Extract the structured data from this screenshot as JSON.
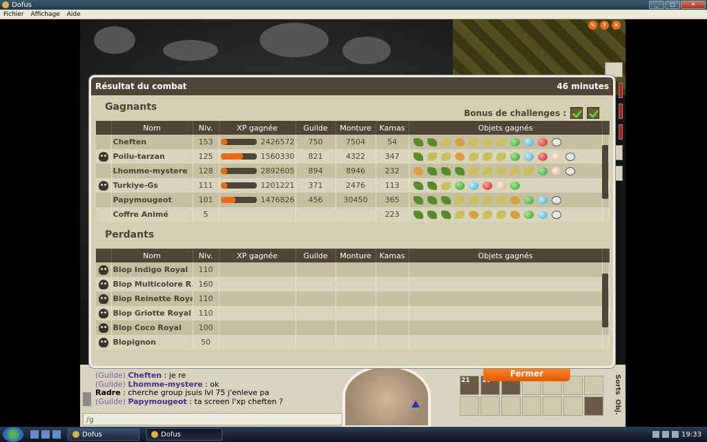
{
  "window": {
    "title": "Dofus"
  },
  "menu": [
    "Fichier",
    "Affichage",
    "Aide"
  ],
  "panel": {
    "title": "Résultat du combat",
    "duration": "46 minutes",
    "bonus_label": "Bonus de challenges :",
    "winners_title": "Gagnants",
    "losers_title": "Perdants",
    "columns": {
      "name": "Nom",
      "level": "Niv.",
      "xp": "XP gagnée",
      "guild": "Guilde",
      "mount": "Monture",
      "kamas": "Kamas",
      "items": "Objets gagnés"
    },
    "winners": [
      {
        "name": "Cheften",
        "dead": false,
        "level": "153",
        "xp": "2426572",
        "xp_fill": 0.18,
        "guild": "750",
        "mount": "7504",
        "kamas": "54",
        "items": [
          "g",
          "g",
          "y",
          "o",
          "y",
          "y",
          "y",
          "gr",
          "bl",
          "r",
          "d"
        ]
      },
      {
        "name": "Poilu-tarzan",
        "dead": true,
        "level": "125",
        "xp": "1560330",
        "xp_fill": 0.62,
        "guild": "821",
        "mount": "4322",
        "kamas": "347",
        "items": [
          "g",
          "y",
          "y",
          "o",
          "y",
          "y",
          "y",
          "gr",
          "bl",
          "r",
          "pe",
          "d"
        ]
      },
      {
        "name": "Lhomme-mystere",
        "dead": false,
        "level": "128",
        "xp": "2892605",
        "xp_fill": 0.0,
        "guild": "894",
        "mount": "8946",
        "kamas": "232",
        "items": [
          "o",
          "g",
          "g",
          "g",
          "y",
          "y",
          "y",
          "y",
          "y",
          "gr",
          "pe",
          "d"
        ]
      },
      {
        "name": "Turkiye-Gs",
        "dead": true,
        "level": "111",
        "xp": "1201221",
        "xp_fill": 0.18,
        "guild": "371",
        "mount": "2476",
        "kamas": "113",
        "items": [
          "g",
          "g",
          "y",
          "gr",
          "bl",
          "r",
          "pe",
          "gr"
        ]
      },
      {
        "name": "Papymougeot",
        "dead": false,
        "level": "101",
        "xp": "1476826",
        "xp_fill": 0.42,
        "guild": "456",
        "mount": "30450",
        "kamas": "365",
        "items": [
          "g",
          "g",
          "g",
          "y",
          "y",
          "y",
          "y",
          "o",
          "gr",
          "bl",
          "d"
        ]
      },
      {
        "name": "Coffre Animé",
        "dead": false,
        "level": "5",
        "xp": "",
        "xp_fill": null,
        "guild": "",
        "mount": "",
        "kamas": "223",
        "items": [
          "g",
          "g",
          "g",
          "y",
          "o",
          "y",
          "y",
          "o",
          "gr",
          "bl",
          "d"
        ]
      }
    ],
    "losers": [
      {
        "name": "Blop Indigo Royal",
        "level": "110"
      },
      {
        "name": "Blop Multicolore R...",
        "level": "160"
      },
      {
        "name": "Blop Reinette Roya",
        "level": "110"
      },
      {
        "name": "Blop Griotte Royal",
        "level": "110"
      },
      {
        "name": "Blop Coco Royal",
        "level": "100"
      },
      {
        "name": "Blopignon",
        "level": "50"
      }
    ]
  },
  "chat": {
    "lines": [
      {
        "channel": "(Guilde)",
        "name": "Cheften",
        "text": " : je re"
      },
      {
        "channel": "(Guilde)",
        "name": "Lhomme-mystere",
        "text": " : ok"
      },
      {
        "channel": "",
        "name": "Radre",
        "text": " : cherche group jsuis lvl 75 j'enleve pa"
      },
      {
        "channel": "(Guilde)",
        "name": "Papymougeot",
        "text": " : ta screen l'xp cheften ?"
      }
    ],
    "input_value": "/g"
  },
  "hud": {
    "close_label": "Fermer",
    "slot1_count": "21",
    "slot2_count": "16",
    "tab_sorts": "Sorts",
    "tab_obj": "Obj."
  },
  "taskbar": {
    "tasks": [
      "Dofus",
      "Dofus"
    ],
    "clock": "19:33"
  },
  "colors": {
    "panel_header": "#4e4536",
    "panel_bg": "#d4cfb3",
    "xp_fill": "#f06a10",
    "close_button": "#f07a20"
  }
}
